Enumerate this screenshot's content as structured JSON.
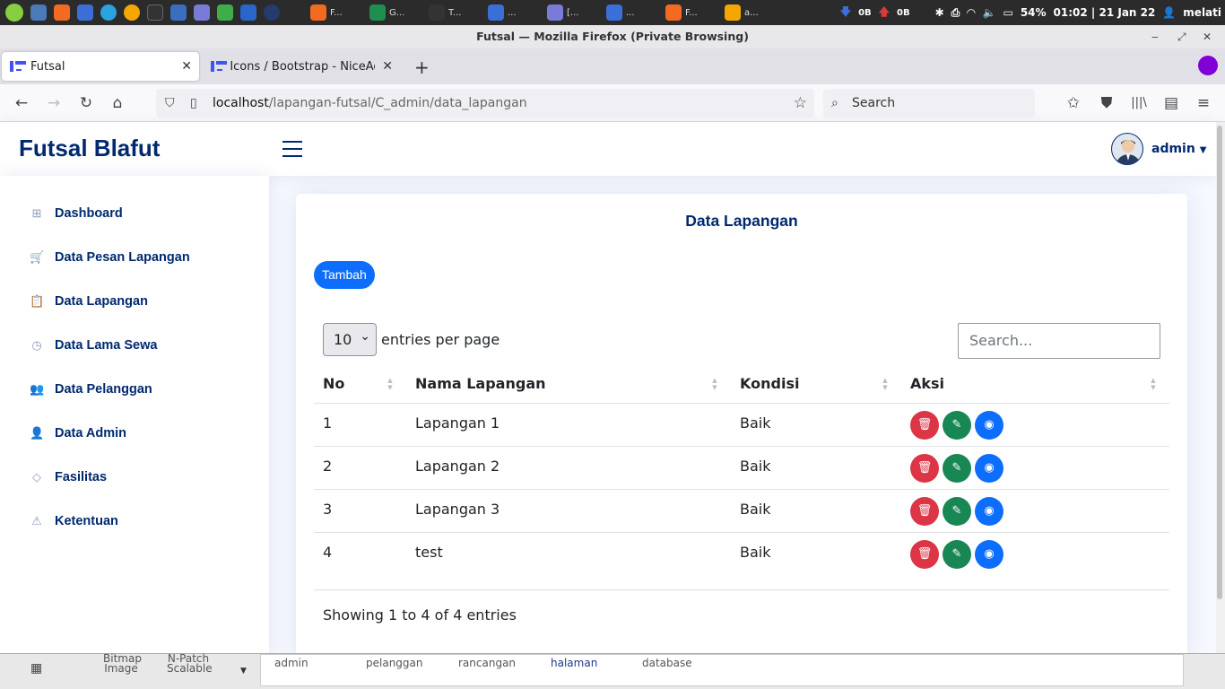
{
  "taskbar": {
    "apps": [
      {
        "label": "F...",
        "icon": "firefox-icon",
        "color": "#f36b21"
      },
      {
        "label": "G...",
        "icon": "gitkraken-icon",
        "color": "#1e8f4e"
      },
      {
        "label": "T...",
        "icon": "terminal-icon",
        "color": "#333333"
      },
      {
        "label": "...",
        "icon": "document-icon",
        "color": "#3b6fd8"
      },
      {
        "label": "[...",
        "icon": "text-editor-icon",
        "color": "#7a7ad8"
      },
      {
        "label": "...",
        "icon": "file-icon",
        "color": "#3b6fd8"
      },
      {
        "label": "F...",
        "icon": "firefox-icon",
        "color": "#f36b21"
      },
      {
        "label": "a...",
        "icon": "app-p-icon",
        "color": "#f5a700"
      }
    ],
    "net_down": "0B",
    "net_up": "0B",
    "battery": "54%",
    "clock": "01:02 | 21 Jan 22",
    "user": "melati"
  },
  "window": {
    "title": "Futsal — Mozilla Firefox (Private Browsing)"
  },
  "browser": {
    "tabs": [
      {
        "label": "Futsal",
        "active": true
      },
      {
        "label": "Icons / Bootstrap - NiceAdm",
        "active": false
      }
    ],
    "url_host": "localhost",
    "url_path": "/lapangan-futsal/C_admin/data_lapangan",
    "search_placeholder": "Search"
  },
  "header": {
    "brand": "Futsal Blafut",
    "user_name": "admin"
  },
  "sidebar": {
    "items": [
      {
        "label": "Dashboard",
        "icon": "grid-icon",
        "glyph": "⊞"
      },
      {
        "label": "Data Pesan Lapangan",
        "icon": "cart-icon",
        "glyph": "🛒"
      },
      {
        "label": "Data Lapangan",
        "icon": "clipboard-icon",
        "glyph": "📋"
      },
      {
        "label": "Data Lama Sewa",
        "icon": "clock-icon",
        "glyph": "◷"
      },
      {
        "label": "Data Pelanggan",
        "icon": "people-icon",
        "glyph": "👥"
      },
      {
        "label": "Data Admin",
        "icon": "person-icon",
        "glyph": "👤"
      },
      {
        "label": "Fasilitas",
        "icon": "gem-icon",
        "glyph": "◇"
      },
      {
        "label": "Ketentuan",
        "icon": "warning-icon",
        "glyph": "⚠"
      }
    ]
  },
  "main": {
    "title": "Data Lapangan",
    "add_button": "Tambah",
    "per_page_value": "10",
    "per_page_label": "entries per page",
    "search_placeholder": "Search...",
    "columns": [
      "No",
      "Nama Lapangan",
      "Kondisi",
      "Aksi"
    ],
    "rows": [
      {
        "no": "1",
        "nama": "Lapangan 1",
        "kondisi": "Baik"
      },
      {
        "no": "2",
        "nama": "Lapangan 2",
        "kondisi": "Baik"
      },
      {
        "no": "3",
        "nama": "Lapangan 3",
        "kondisi": "Baik"
      },
      {
        "no": "4",
        "nama": "test",
        "kondisi": "Baik"
      }
    ],
    "info": "Showing 1 to 4 of 4 entries"
  },
  "bottom_panel": {
    "items": [
      "Bitmap Image",
      "N-Patch Scalable",
      "admin",
      "pelanggan",
      "rancangan",
      "halaman",
      "database"
    ]
  }
}
